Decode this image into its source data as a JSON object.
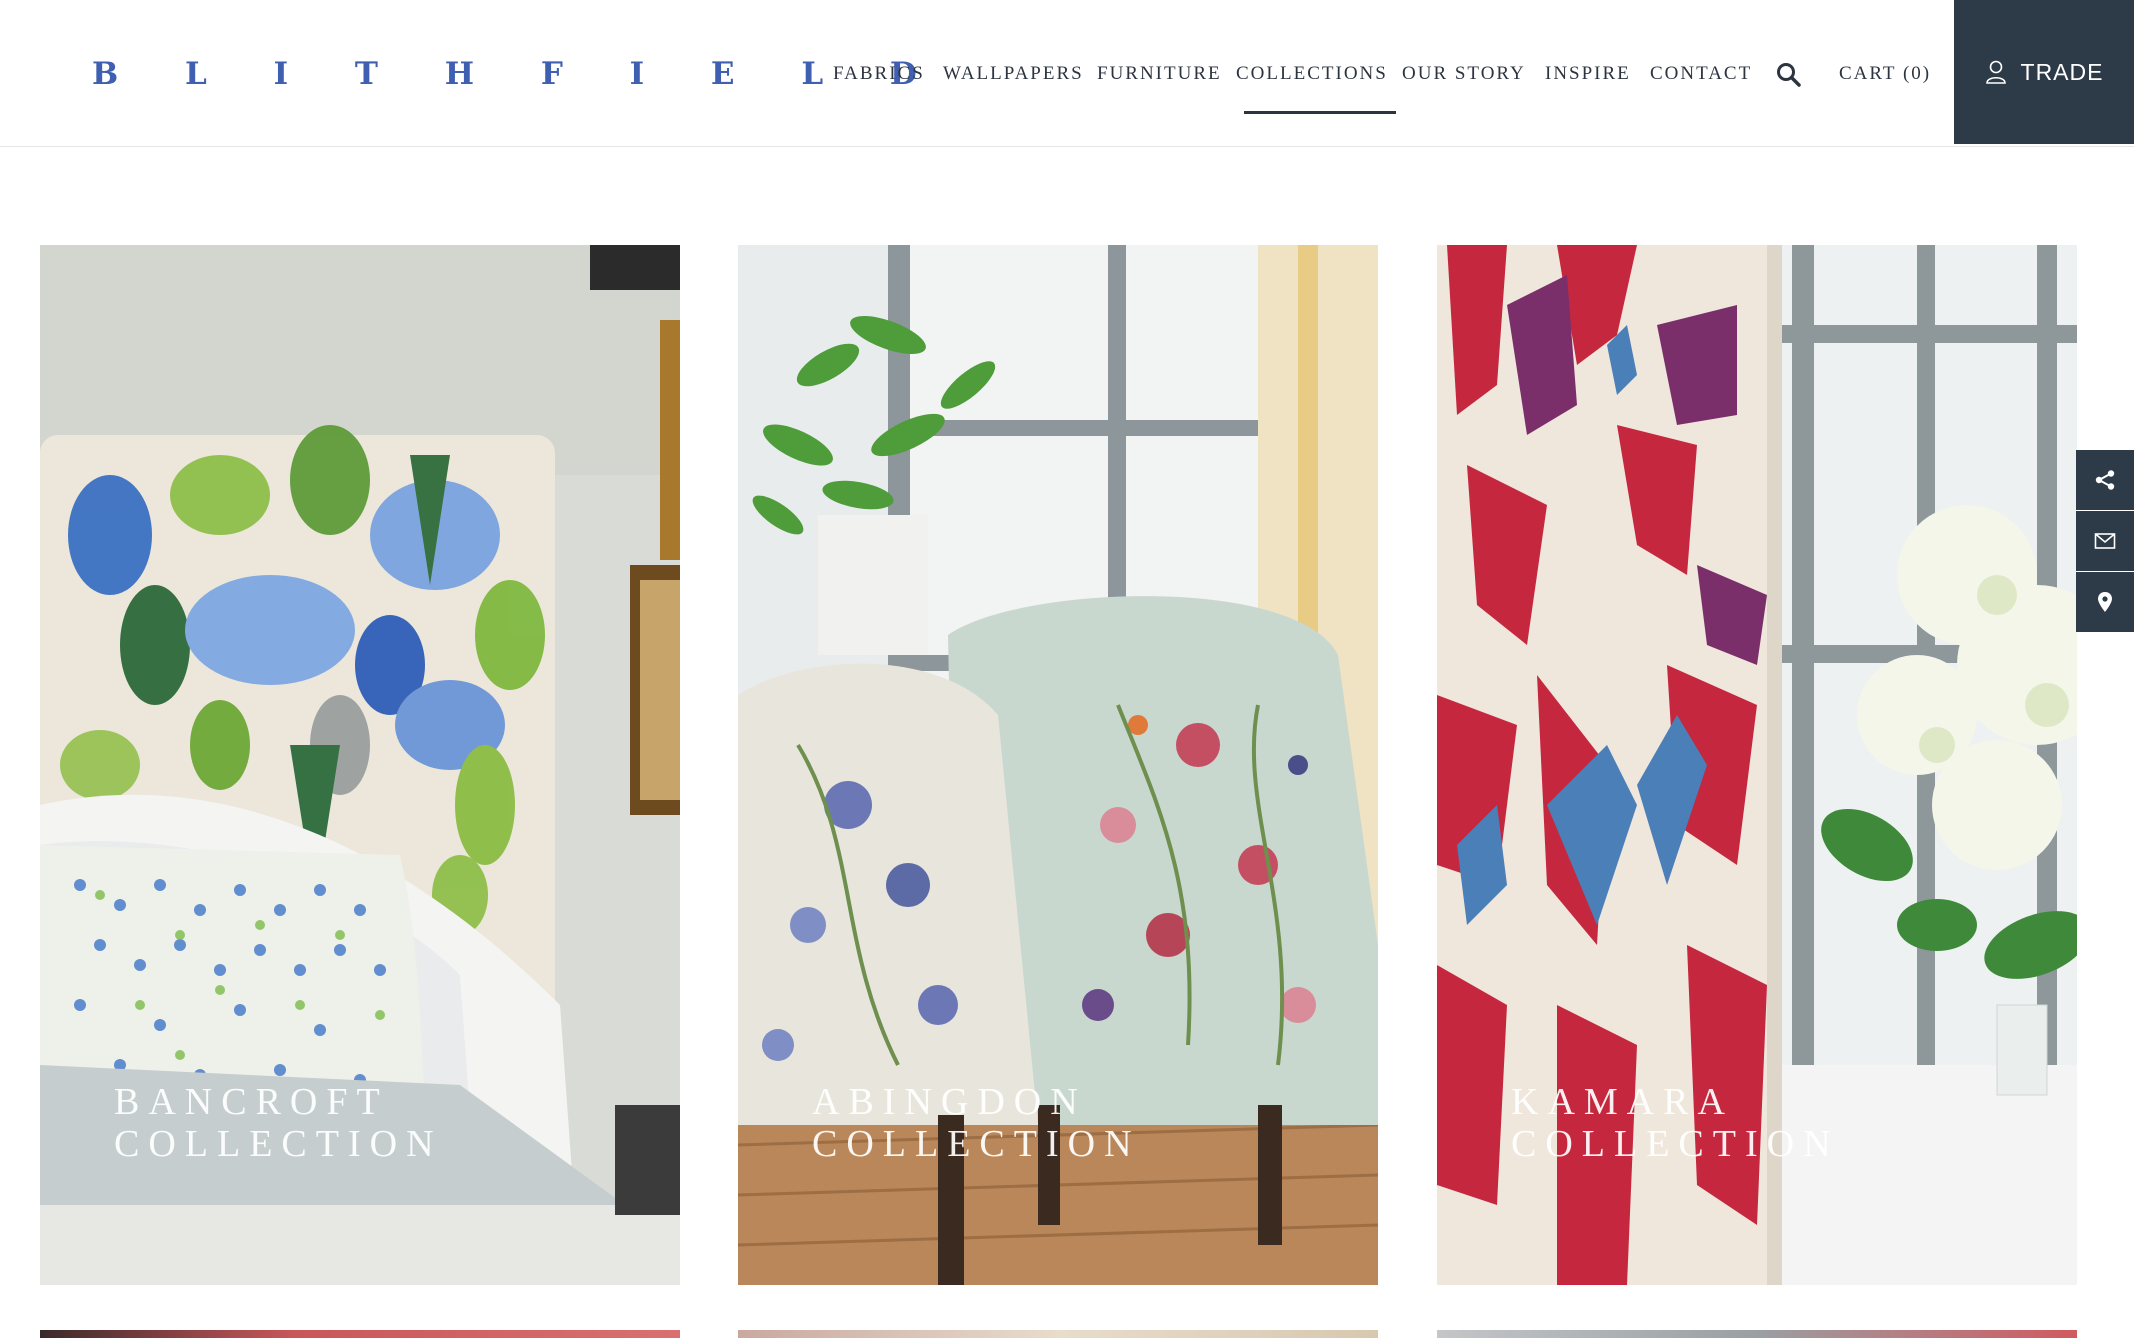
{
  "brand": {
    "logo_text": "BLITHFIELD",
    "logo_color": "#3f5fb0"
  },
  "nav": {
    "items": [
      {
        "label": "FABRICS"
      },
      {
        "label": "WALLPAPERS"
      },
      {
        "label": "FURNITURE"
      },
      {
        "label": "COLLECTIONS",
        "active": true
      },
      {
        "label": "OUR STORY"
      },
      {
        "label": "INSPIRE"
      },
      {
        "label": "CONTACT"
      }
    ],
    "search_icon": "search-icon",
    "cart_label": "CART (0)",
    "trade_label": "TRADE",
    "trade_icon": "user-icon"
  },
  "collections": [
    {
      "title": "BANCROFT\nCOLLECTION"
    },
    {
      "title": "ABINGDON\nCOLLECTION"
    },
    {
      "title": "KAMARA\nCOLLECTION"
    }
  ],
  "side_dock": [
    {
      "icon": "share-icon"
    },
    {
      "icon": "mail-icon"
    },
    {
      "icon": "map-pin-icon"
    }
  ],
  "colors": {
    "accent_dark": "#2d3a48",
    "text": "#2c3440"
  }
}
